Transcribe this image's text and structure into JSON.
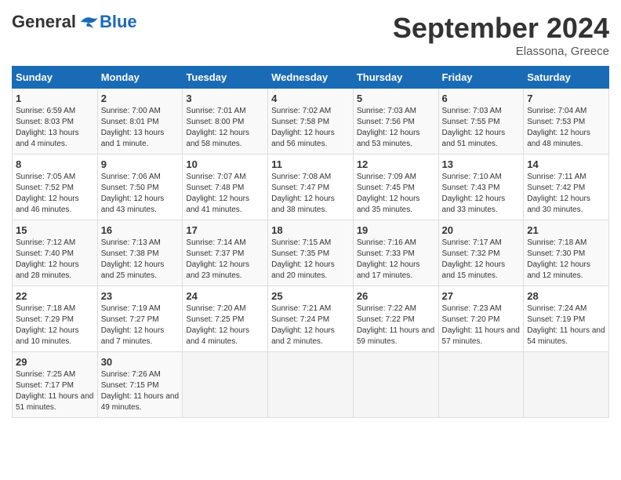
{
  "header": {
    "logo_general": "General",
    "logo_blue": "Blue",
    "month_title": "September 2024",
    "location": "Elassona, Greece"
  },
  "days_of_week": [
    "Sunday",
    "Monday",
    "Tuesday",
    "Wednesday",
    "Thursday",
    "Friday",
    "Saturday"
  ],
  "weeks": [
    [
      {
        "day": "1",
        "sunrise": "6:59 AM",
        "sunset": "8:03 PM",
        "daylight": "13 hours and 4 minutes."
      },
      {
        "day": "2",
        "sunrise": "7:00 AM",
        "sunset": "8:01 PM",
        "daylight": "13 hours and 1 minute."
      },
      {
        "day": "3",
        "sunrise": "7:01 AM",
        "sunset": "8:00 PM",
        "daylight": "12 hours and 58 minutes."
      },
      {
        "day": "4",
        "sunrise": "7:02 AM",
        "sunset": "7:58 PM",
        "daylight": "12 hours and 56 minutes."
      },
      {
        "day": "5",
        "sunrise": "7:03 AM",
        "sunset": "7:56 PM",
        "daylight": "12 hours and 53 minutes."
      },
      {
        "day": "6",
        "sunrise": "7:03 AM",
        "sunset": "7:55 PM",
        "daylight": "12 hours and 51 minutes."
      },
      {
        "day": "7",
        "sunrise": "7:04 AM",
        "sunset": "7:53 PM",
        "daylight": "12 hours and 48 minutes."
      }
    ],
    [
      {
        "day": "8",
        "sunrise": "7:05 AM",
        "sunset": "7:52 PM",
        "daylight": "12 hours and 46 minutes."
      },
      {
        "day": "9",
        "sunrise": "7:06 AM",
        "sunset": "7:50 PM",
        "daylight": "12 hours and 43 minutes."
      },
      {
        "day": "10",
        "sunrise": "7:07 AM",
        "sunset": "7:48 PM",
        "daylight": "12 hours and 41 minutes."
      },
      {
        "day": "11",
        "sunrise": "7:08 AM",
        "sunset": "7:47 PM",
        "daylight": "12 hours and 38 minutes."
      },
      {
        "day": "12",
        "sunrise": "7:09 AM",
        "sunset": "7:45 PM",
        "daylight": "12 hours and 35 minutes."
      },
      {
        "day": "13",
        "sunrise": "7:10 AM",
        "sunset": "7:43 PM",
        "daylight": "12 hours and 33 minutes."
      },
      {
        "day": "14",
        "sunrise": "7:11 AM",
        "sunset": "7:42 PM",
        "daylight": "12 hours and 30 minutes."
      }
    ],
    [
      {
        "day": "15",
        "sunrise": "7:12 AM",
        "sunset": "7:40 PM",
        "daylight": "12 hours and 28 minutes."
      },
      {
        "day": "16",
        "sunrise": "7:13 AM",
        "sunset": "7:38 PM",
        "daylight": "12 hours and 25 minutes."
      },
      {
        "day": "17",
        "sunrise": "7:14 AM",
        "sunset": "7:37 PM",
        "daylight": "12 hours and 23 minutes."
      },
      {
        "day": "18",
        "sunrise": "7:15 AM",
        "sunset": "7:35 PM",
        "daylight": "12 hours and 20 minutes."
      },
      {
        "day": "19",
        "sunrise": "7:16 AM",
        "sunset": "7:33 PM",
        "daylight": "12 hours and 17 minutes."
      },
      {
        "day": "20",
        "sunrise": "7:17 AM",
        "sunset": "7:32 PM",
        "daylight": "12 hours and 15 minutes."
      },
      {
        "day": "21",
        "sunrise": "7:18 AM",
        "sunset": "7:30 PM",
        "daylight": "12 hours and 12 minutes."
      }
    ],
    [
      {
        "day": "22",
        "sunrise": "7:18 AM",
        "sunset": "7:29 PM",
        "daylight": "12 hours and 10 minutes."
      },
      {
        "day": "23",
        "sunrise": "7:19 AM",
        "sunset": "7:27 PM",
        "daylight": "12 hours and 7 minutes."
      },
      {
        "day": "24",
        "sunrise": "7:20 AM",
        "sunset": "7:25 PM",
        "daylight": "12 hours and 4 minutes."
      },
      {
        "day": "25",
        "sunrise": "7:21 AM",
        "sunset": "7:24 PM",
        "daylight": "12 hours and 2 minutes."
      },
      {
        "day": "26",
        "sunrise": "7:22 AM",
        "sunset": "7:22 PM",
        "daylight": "11 hours and 59 minutes."
      },
      {
        "day": "27",
        "sunrise": "7:23 AM",
        "sunset": "7:20 PM",
        "daylight": "11 hours and 57 minutes."
      },
      {
        "day": "28",
        "sunrise": "7:24 AM",
        "sunset": "7:19 PM",
        "daylight": "11 hours and 54 minutes."
      }
    ],
    [
      {
        "day": "29",
        "sunrise": "7:25 AM",
        "sunset": "7:17 PM",
        "daylight": "11 hours and 51 minutes."
      },
      {
        "day": "30",
        "sunrise": "7:26 AM",
        "sunset": "7:15 PM",
        "daylight": "11 hours and 49 minutes."
      },
      null,
      null,
      null,
      null,
      null
    ]
  ]
}
